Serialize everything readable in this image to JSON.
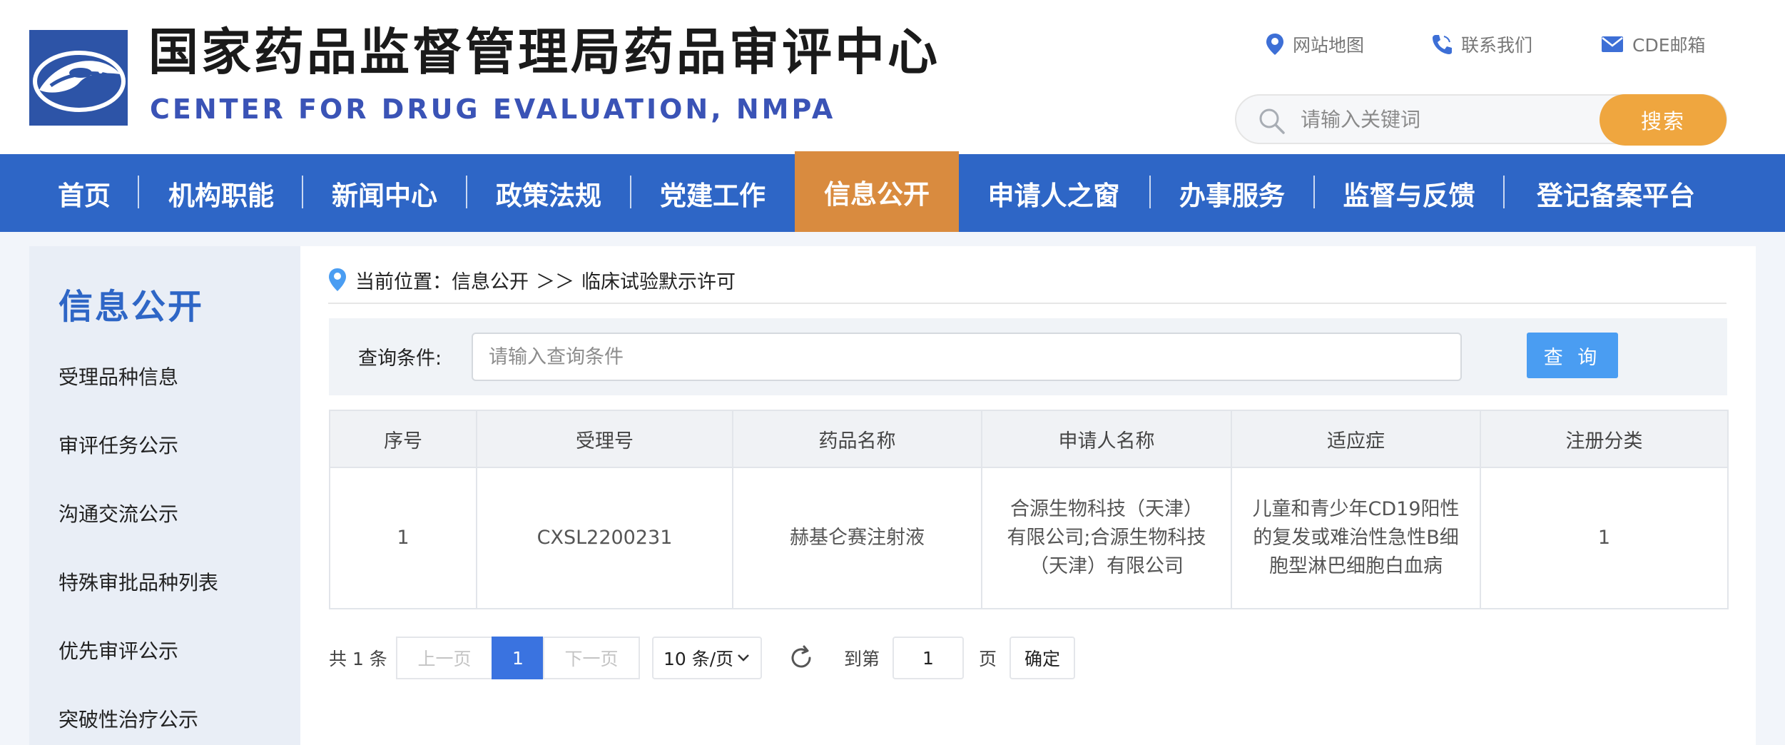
{
  "header": {
    "title_cn": "国家药品监督管理局药品审评中心",
    "title_en": "CENTER FOR DRUG EVALUATION, NMPA",
    "utilities": [
      {
        "label": "网站地图",
        "icon": "map-pin-icon"
      },
      {
        "label": "联系我们",
        "icon": "phone-icon"
      },
      {
        "label": "CDE邮箱",
        "icon": "mail-icon"
      }
    ],
    "search": {
      "placeholder": "请输入关键词",
      "button": "搜索"
    }
  },
  "nav": {
    "items": [
      {
        "label": "首页"
      },
      {
        "label": "机构职能"
      },
      {
        "label": "新闻中心"
      },
      {
        "label": "政策法规"
      },
      {
        "label": "党建工作"
      },
      {
        "label": "信息公开",
        "active": true
      },
      {
        "label": "申请人之窗"
      },
      {
        "label": "办事服务"
      },
      {
        "label": "监督与反馈"
      },
      {
        "label": "登记备案平台"
      }
    ],
    "active_color": "#d98b3f",
    "bar_color": "#2e66c6"
  },
  "sidebar": {
    "title": "信息公开",
    "items": [
      {
        "label": "受理品种信息"
      },
      {
        "label": "审评任务公示"
      },
      {
        "label": "沟通交流公示"
      },
      {
        "label": "特殊审批品种列表"
      },
      {
        "label": "优先审评公示"
      },
      {
        "label": "突破性治疗公示"
      }
    ]
  },
  "breadcrumb": {
    "prefix": "当前位置：",
    "section": "信息公开",
    "separator": "＞＞",
    "current": "临床试验默示许可"
  },
  "query": {
    "label": "查询条件:",
    "placeholder": "请输入查询条件",
    "button": "查 询"
  },
  "table": {
    "headers": [
      "序号",
      "受理号",
      "药品名称",
      "申请人名称",
      "适应症",
      "注册分类"
    ],
    "rows": [
      [
        "1",
        "CXSL2200231",
        "赫基仑赛注射液",
        "合源生物科技（天津）有限公司;合源生物科技（天津）有限公司",
        "儿童和青少年CD19阳性的复发或难治性急性B细胞型淋巴细胞白血病",
        "1"
      ]
    ]
  },
  "pagination": {
    "total": "共 1 条",
    "prev": "上一页",
    "current_page": "1",
    "next": "下一页",
    "page_size": "10 条/页",
    "goto_label": "到第",
    "goto_value": "1",
    "goto_unit": "页",
    "confirm": "确定"
  }
}
